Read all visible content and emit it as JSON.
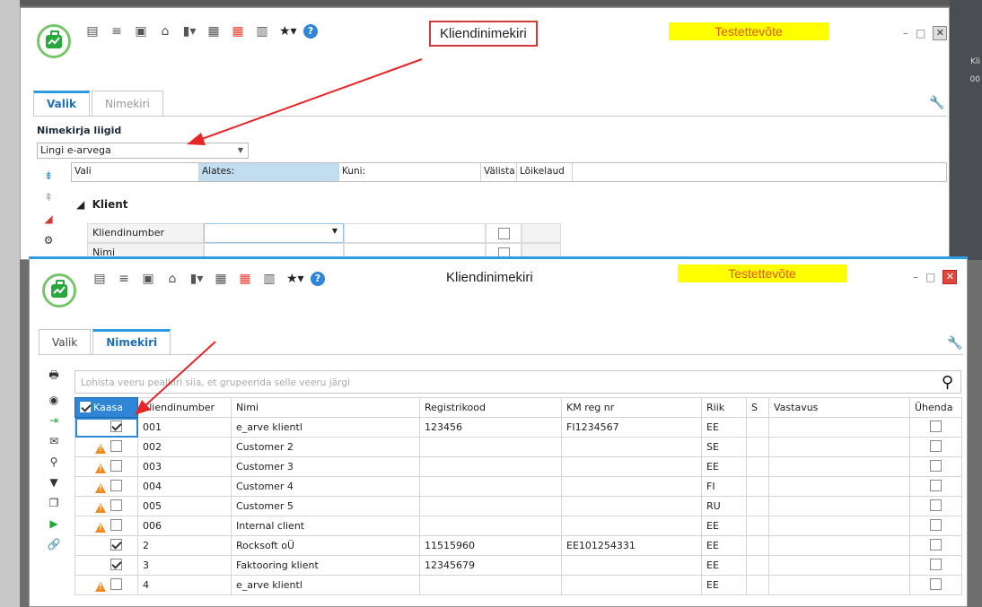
{
  "desktop": {
    "ghost_text_1": "Kli",
    "ghost_text_2": "00"
  },
  "back_window": {
    "title": "Kliendinimekiri",
    "company": "Testettevõte",
    "tabs": [
      {
        "label": "Valik"
      },
      {
        "label": "Nimekiri"
      }
    ],
    "section_label": "Nimekirja liigid",
    "list_type_value": "Lingi e-arvega",
    "filter_headers": [
      "Vali",
      "Alates:",
      "Kuni:",
      "Välista",
      "Lõikelaud"
    ],
    "group_label": "Klient",
    "filter_rows": [
      {
        "label": "Kliendinumber"
      },
      {
        "label": "Nimi"
      }
    ]
  },
  "front_window": {
    "title": "Kliendinimekiri",
    "company": "Testettevõte",
    "tabs": [
      {
        "label": "Valik"
      },
      {
        "label": "Nimekiri"
      }
    ],
    "group_hint": "Lohista veeru pealkiri siia, et grupeerida selle veeru järgi",
    "columns": [
      "Kaasa",
      "Kliendinumber",
      "Nimi",
      "Registrikood",
      "KM reg nr",
      "Riik",
      "S",
      "Vastavus",
      "Ühenda"
    ],
    "rows": [
      {
        "warn": false,
        "checked": true,
        "num": "001",
        "name": "e_arve klientl",
        "reg": "123456",
        "km": "FI1234567",
        "country": "EE"
      },
      {
        "warn": true,
        "checked": false,
        "num": "002",
        "name": "Customer 2",
        "reg": "",
        "km": "",
        "country": "SE"
      },
      {
        "warn": true,
        "checked": false,
        "num": "003",
        "name": "Customer 3",
        "reg": "",
        "km": "",
        "country": "EE"
      },
      {
        "warn": true,
        "checked": false,
        "num": "004",
        "name": "Customer 4",
        "reg": "",
        "km": "",
        "country": "FI"
      },
      {
        "warn": true,
        "checked": false,
        "num": "005",
        "name": "Customer 5",
        "reg": "",
        "km": "",
        "country": "RU"
      },
      {
        "warn": true,
        "checked": false,
        "num": "006",
        "name": "Internal client",
        "reg": "",
        "km": "",
        "country": "EE"
      },
      {
        "warn": false,
        "checked": true,
        "num": "2",
        "name": "Rocksoft oÜ",
        "reg": "11515960",
        "km": "EE101254331",
        "country": "EE"
      },
      {
        "warn": false,
        "checked": true,
        "num": "3",
        "name": "Faktooring klient",
        "reg": "12345679",
        "km": "",
        "country": "EE"
      },
      {
        "warn": true,
        "checked": false,
        "num": "4",
        "name": "e_arve klientl",
        "reg": "",
        "km": "",
        "country": "EE"
      }
    ]
  },
  "colors": {
    "accent": "#2f9be0",
    "annotation": "#e8262a",
    "warning": "#f28a1e",
    "company_bg": "#ffff00"
  }
}
